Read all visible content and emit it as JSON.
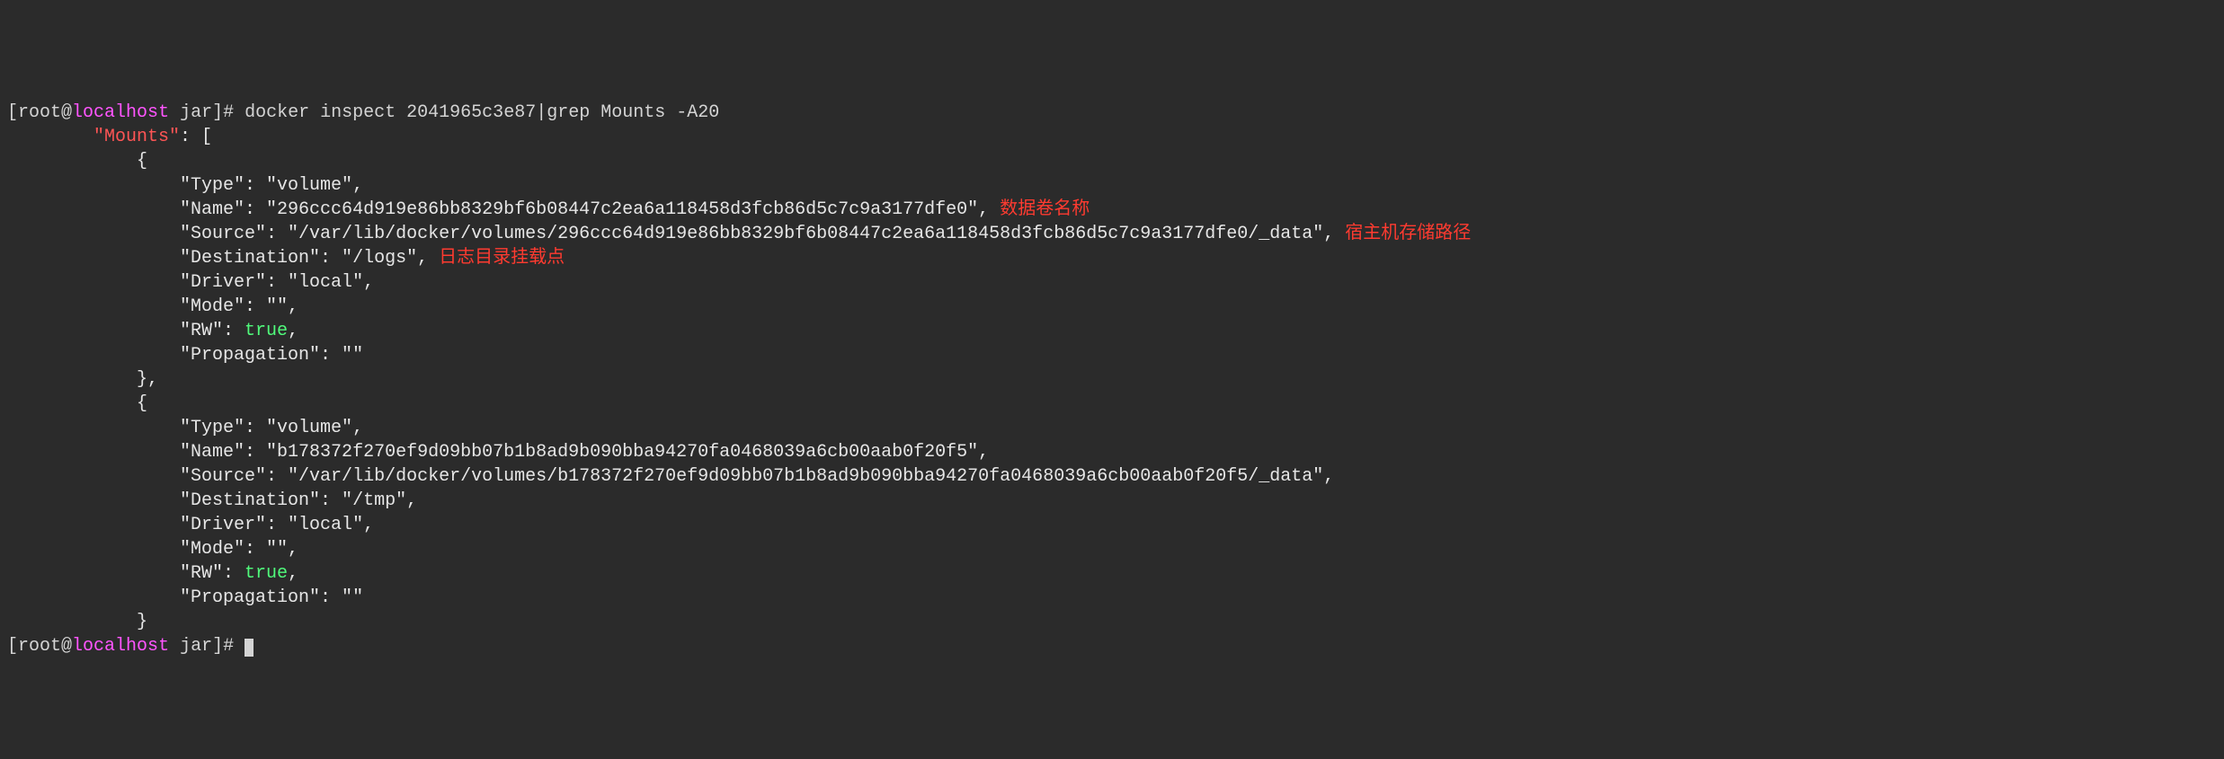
{
  "prompt": {
    "open": "[",
    "user": "root",
    "at": "@",
    "host": "localhost",
    "sep": " ",
    "dir": "jar",
    "close": "]#",
    "sp": " "
  },
  "command": "docker inspect 2041965c3e87|grep Mounts -A20",
  "line_mounts_indent": "        ",
  "line_mounts_key": "\"Mounts\"",
  "line_mounts_rest": ": [",
  "brace_open_indent": "            {",
  "mnt1": {
    "type": "                \"Type\": \"volume\",",
    "name_pre": "                \"Name\": \"296ccc64d919e86bb8329bf6b08447c2ea6a118458d3fcb86d5c7c9a3177dfe0\",",
    "name_anno": " 数据卷名称",
    "src_pre": "                \"Source\": \"/var/lib/docker/volumes/296ccc64d919e86bb8329bf6b08447c2ea6a118458d3fcb86d5c7c9a3177dfe0/_data\",",
    "src_anno": " 宿主机存储路径",
    "dest_pre": "                \"Destination\": \"/logs\",",
    "dest_anno": " 日志目录挂载点",
    "driver": "                \"Driver\": \"local\",",
    "mode": "                \"Mode\": \"\",",
    "rw_pre": "                \"RW\": ",
    "rw_val": "true",
    "rw_post": ",",
    "prop": "                \"Propagation\": \"\""
  },
  "brace_close_comma": "            },",
  "brace_open_indent2": "            {",
  "mnt2": {
    "type": "                \"Type\": \"volume\",",
    "name": "                \"Name\": \"b178372f270ef9d09bb07b1b8ad9b090bba94270fa0468039a6cb00aab0f20f5\",",
    "src": "                \"Source\": \"/var/lib/docker/volumes/b178372f270ef9d09bb07b1b8ad9b090bba94270fa0468039a6cb00aab0f20f5/_data\",",
    "dest": "                \"Destination\": \"/tmp\",",
    "driver": "                \"Driver\": \"local\",",
    "mode": "                \"Mode\": \"\",",
    "rw_pre": "                \"RW\": ",
    "rw_val": "true",
    "rw_post": ",",
    "prop": "                \"Propagation\": \"\""
  },
  "brace_close": "            }"
}
